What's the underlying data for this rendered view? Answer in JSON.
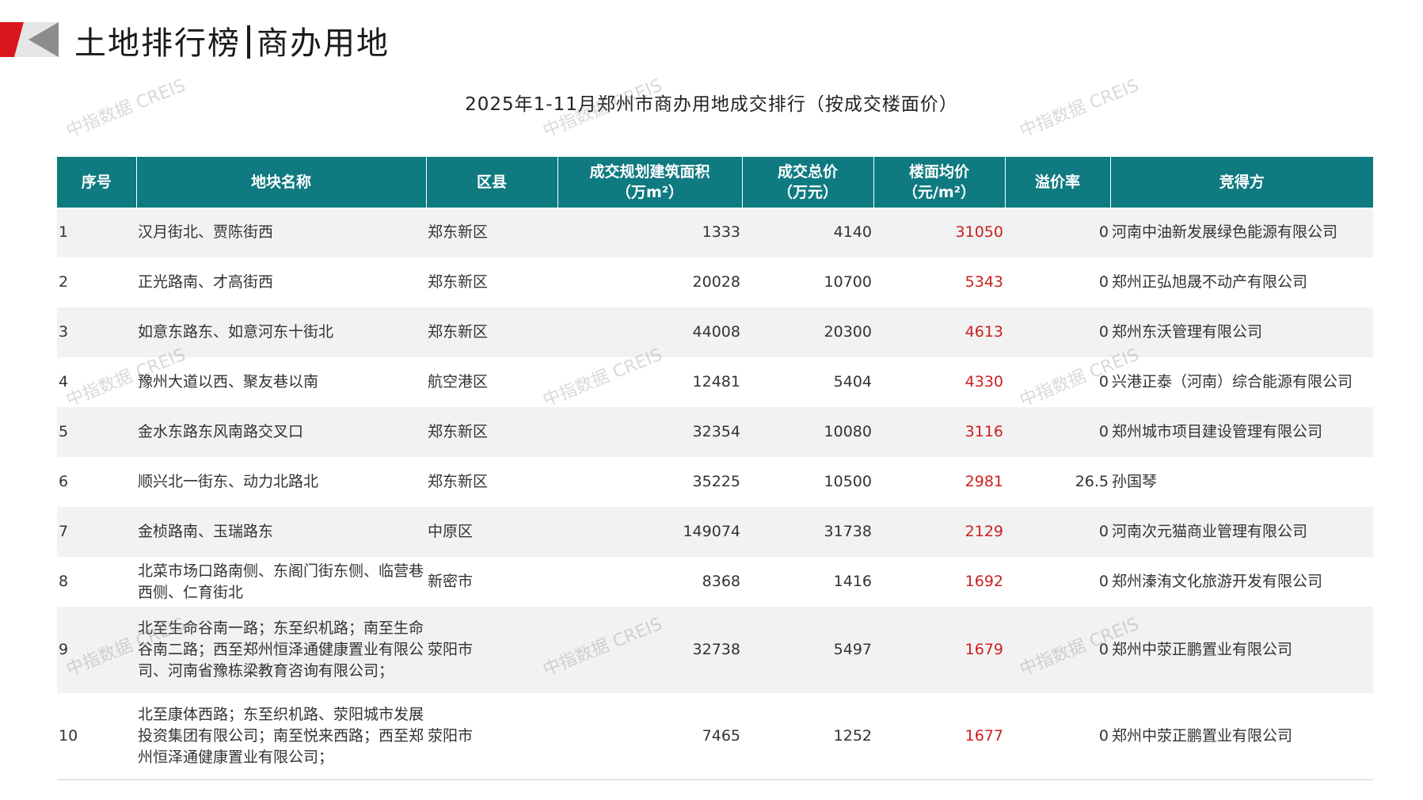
{
  "header": {
    "title_left": "土地排行榜",
    "title_right": "商办用地"
  },
  "subtitle": "2025年1-11月郑州市商办用地成交排行（按成交楼面价）",
  "watermark": "中指数据 CREIS",
  "colors": {
    "header_bg": "#0f7a80",
    "price": "#cc1f1f",
    "logo_red": "#d9141b",
    "logo_gray": "#8c8c8c"
  },
  "table": {
    "columns": [
      "序号",
      "地块名称",
      "区县",
      "成交规划建筑面积\n（万m²）",
      "成交总价\n（万元）",
      "楼面均价\n（元/m²）",
      "溢价率",
      "竞得方"
    ],
    "rows": [
      [
        "1",
        "汉月街北、贾陈街西",
        "郑东新区",
        "1333",
        "4140",
        "31050",
        "0",
        "河南中油新发展绿色能源有限公司"
      ],
      [
        "2",
        "正光路南、才高街西",
        "郑东新区",
        "20028",
        "10700",
        "5343",
        "0",
        "郑州正弘旭晟不动产有限公司"
      ],
      [
        "3",
        "如意东路东、如意河东十街北",
        "郑东新区",
        "44008",
        "20300",
        "4613",
        "0",
        "郑州东沃管理有限公司"
      ],
      [
        "4",
        "豫州大道以西、聚友巷以南",
        "航空港区",
        "12481",
        "5404",
        "4330",
        "0",
        "兴港正泰（河南）综合能源有限公司"
      ],
      [
        "5",
        "金水东路东风南路交叉口",
        "郑东新区",
        "32354",
        "10080",
        "3116",
        "0",
        "郑州城市项目建设管理有限公司"
      ],
      [
        "6",
        "顺兴北一街东、动力北路北",
        "郑东新区",
        "35225",
        "10500",
        "2981",
        "26.5",
        "孙国琴"
      ],
      [
        "7",
        "金桢路南、玉瑞路东",
        "中原区",
        "149074",
        "31738",
        "2129",
        "0",
        "河南次元猫商业管理有限公司"
      ],
      [
        "8",
        "北菜市场口路南侧、东阁门街东侧、临营巷西侧、仁育街北",
        "新密市",
        "8368",
        "1416",
        "1692",
        "0",
        "郑州溱洧文化旅游开发有限公司"
      ],
      [
        "9",
        "北至生命谷南一路；东至织机路；南至生命谷南二路；西至郑州恒泽通健康置业有限公司、河南省豫栋梁教育咨询有限公司；",
        "荥阳市",
        "32738",
        "5497",
        "1679",
        "0",
        "郑州中荥正鹏置业有限公司"
      ],
      [
        "10",
        "北至康体西路；东至织机路、荥阳城市发展投资集团有限公司；南至悦来西路；西至郑州恒泽通健康置业有限公司；",
        "荥阳市",
        "7465",
        "1252",
        "1677",
        "0",
        "郑州中荥正鹏置业有限公司"
      ]
    ]
  }
}
